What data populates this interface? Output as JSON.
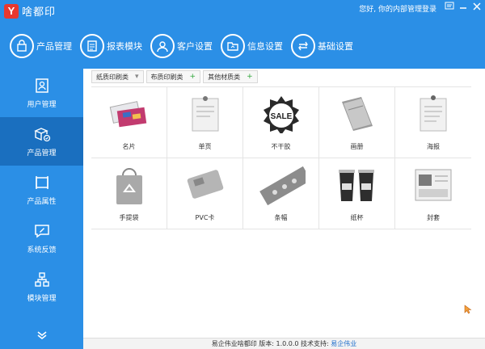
{
  "app": {
    "logo_letter": "Y",
    "name": "啥都印"
  },
  "header": {
    "user_info": "您好, 你的内部管理登录"
  },
  "topnav": [
    {
      "label": "产品管理",
      "icon": "shopping-bag-icon"
    },
    {
      "label": "报表模块",
      "icon": "report-icon"
    },
    {
      "label": "客户设置",
      "icon": "user-icon"
    },
    {
      "label": "信息设置",
      "icon": "folder-icon"
    },
    {
      "label": "基础设置",
      "icon": "settings-icon"
    }
  ],
  "sidebar": {
    "items": [
      {
        "label": "用户管理",
        "icon": "user-card-icon",
        "active": false
      },
      {
        "label": "产品管理",
        "icon": "product-box-icon",
        "active": true
      },
      {
        "label": "产品属性",
        "icon": "attribute-icon",
        "active": false
      },
      {
        "label": "系统反馈",
        "icon": "feedback-icon",
        "active": false
      },
      {
        "label": "模块管理",
        "icon": "module-icon",
        "active": false
      }
    ],
    "more_icon": "double-chevron-down-icon"
  },
  "tabs": [
    {
      "label": "纸质印刷类",
      "mark": "▾"
    },
    {
      "label": "布质印刷类",
      "mark": "+"
    },
    {
      "label": "其他材质类",
      "mark": "+"
    }
  ],
  "products": [
    {
      "label": "名片",
      "icon": "business-card-icon"
    },
    {
      "label": "单页",
      "icon": "flyer-icon"
    },
    {
      "label": "不干胶",
      "icon": "sticker-icon"
    },
    {
      "label": "画册",
      "icon": "brochure-icon"
    },
    {
      "label": "海报",
      "icon": "poster-icon"
    },
    {
      "label": "手提袋",
      "icon": "handbag-icon"
    },
    {
      "label": "PVC卡",
      "icon": "pvc-card-icon"
    },
    {
      "label": "条幅",
      "icon": "banner-icon"
    },
    {
      "label": "纸杯",
      "icon": "paper-cup-icon"
    },
    {
      "label": "封套",
      "icon": "envelope-icon"
    }
  ],
  "footer": {
    "company": "易企伟业啥都印",
    "version_label": "版本:",
    "version": "1.0.0.0",
    "support_label": "技术支持:",
    "support": "易企伟业"
  },
  "colors": {
    "primary": "#2b8fe6",
    "active": "#1a6fbf",
    "logo": "#e8382f"
  }
}
